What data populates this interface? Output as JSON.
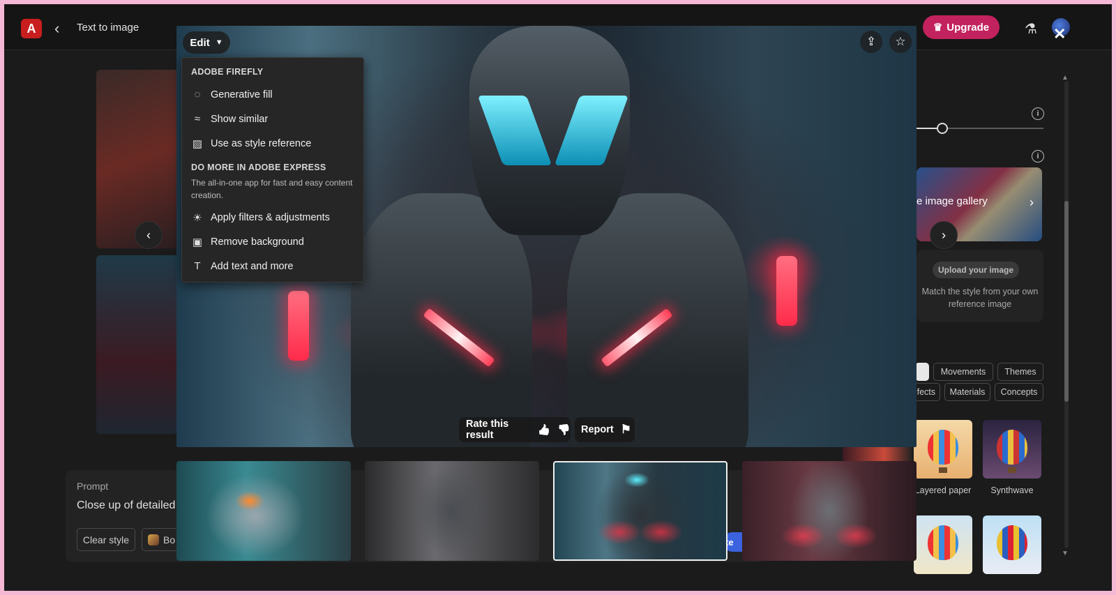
{
  "header": {
    "logo_glyph": "A",
    "back_glyph": "‹",
    "title": "Text to image",
    "upgrade_label": "Upgrade",
    "upgrade_icon": "crown-icon",
    "flask_icon": "flask-icon",
    "avatar_icon": "avatar"
  },
  "modal": {
    "edit_label": "Edit",
    "close_glyph": "✕",
    "share_glyph": "⇪",
    "star_glyph": "☆",
    "rate_label": "Rate this result",
    "report_label": "Report",
    "thumb_up_glyph": "👍",
    "thumb_down_glyph": "👎",
    "flag_glyph": "⚑",
    "selected_thumbnail_index": 2
  },
  "edit_menu": {
    "section1_title": "ADOBE FIREFLY",
    "items1": [
      {
        "label": "Generative fill",
        "icon": "generative-fill-icon",
        "glyph": "◌"
      },
      {
        "label": "Show similar",
        "icon": "show-similar-icon",
        "glyph": "≈"
      },
      {
        "label": "Use as style reference",
        "icon": "image-icon",
        "glyph": "▨"
      }
    ],
    "section2_title": "DO MORE IN ADOBE EXPRESS",
    "section2_desc": "The all-in-one app for fast and easy content creation.",
    "items2": [
      {
        "label": "Apply filters & adjustments",
        "icon": "sun-icon",
        "glyph": "☀"
      },
      {
        "label": "Remove background",
        "icon": "remove-background-icon",
        "glyph": "▣"
      },
      {
        "label": "Add text and more",
        "icon": "text-icon",
        "glyph": "T"
      }
    ]
  },
  "right_panel": {
    "info_glyph": "i",
    "gallery_text": "e image gallery",
    "gallery_chevron": "›",
    "upload_label": "Upload your image",
    "upload_desc": "Match the style from your own reference image",
    "chips_row1": [
      "Movements",
      "Themes"
    ],
    "chips_row2": [
      "fects",
      "Materials",
      "Concepts"
    ],
    "styles": [
      {
        "label": "Layered paper"
      },
      {
        "label": "Synthwave"
      }
    ]
  },
  "prompt": {
    "label": "Prompt",
    "text": "Close up of detailed s",
    "clear_style_label": "Clear style",
    "chip_label": "Bo",
    "generate_peek": "te"
  },
  "nav": {
    "prev_glyph": "‹",
    "next_glyph": "›"
  }
}
